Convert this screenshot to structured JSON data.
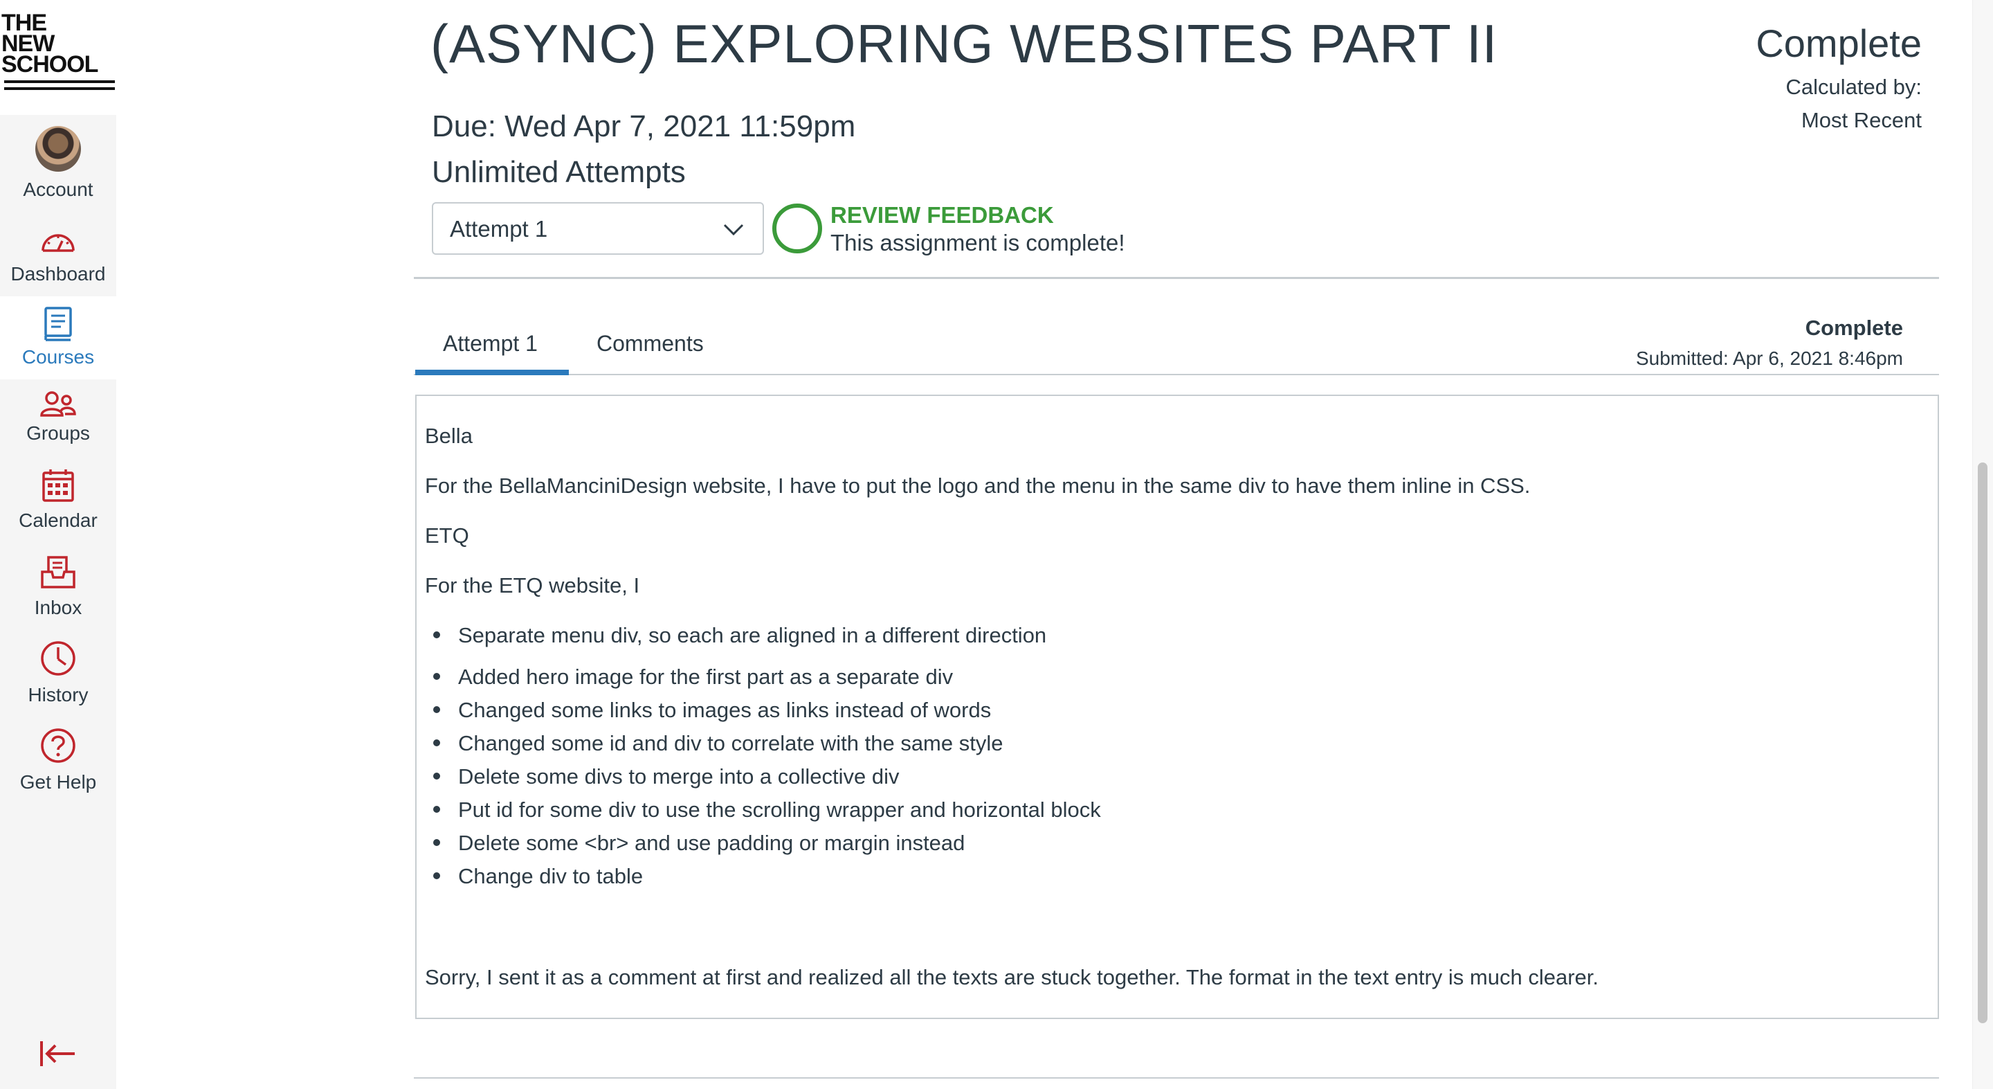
{
  "brand": {
    "logo_lines": [
      "THE",
      "NEW",
      "SCHOOL"
    ]
  },
  "nav": {
    "items": [
      {
        "label": "Account",
        "icon": "avatar"
      },
      {
        "label": "Dashboard",
        "icon": "dashboard-icon"
      },
      {
        "label": "Courses",
        "icon": "courses-icon",
        "active": true
      },
      {
        "label": "Groups",
        "icon": "groups-icon"
      },
      {
        "label": "Calendar",
        "icon": "calendar-icon"
      },
      {
        "label": "Inbox",
        "icon": "inbox-icon"
      },
      {
        "label": "History",
        "icon": "history-icon"
      },
      {
        "label": "Get Help",
        "icon": "help-icon"
      }
    ],
    "collapse_icon": "collapse-nav-icon"
  },
  "assignment": {
    "title": "(ASYNC) EXPLORING WEBSITES PART II",
    "due": "Due: Wed Apr 7, 2021 11:59pm",
    "attempts": "Unlimited Attempts",
    "grade": "Complete",
    "calculated_by_label": "Calculated by:",
    "calculated_by_value": "Most Recent",
    "attempt_select": {
      "value": "Attempt 1"
    },
    "review_feedback": "REVIEW FEEDBACK",
    "complete_message": "This assignment is complete!"
  },
  "tabs": [
    {
      "label": "Attempt 1",
      "active": true
    },
    {
      "label": "Comments",
      "active": false
    }
  ],
  "submission": {
    "status": "Complete",
    "submitted": "Submitted:  Apr 6, 2021 8:46pm",
    "paragraphs": [
      "Bella",
      "For the BellaManciniDesign website, I have to put the logo and the menu in the same div to have them inline in CSS.",
      "ETQ",
      "For the ETQ website, I"
    ],
    "bullets": [
      "Separate menu div, so each are aligned in a different direction",
      "Added hero image for the first part as a separate div",
      "Changed some links to images as links instead of words",
      "Changed some id and div to correlate with the same style",
      "Delete some divs to merge into a collective div",
      "Put id for some div to use the scrolling wrapper and horizontal block",
      "Delete some <br> and use padding or margin instead",
      "Change div to table"
    ],
    "closing": "Sorry, I sent it as a comment at first and realized all the texts are stuck together. The format in the text entry is much clearer."
  },
  "colors": {
    "nav_active": "#2b7abc",
    "icon_red": "#c0262d",
    "feedback_green": "#3b9b3a",
    "text": "#2d3b45",
    "border": "#c7cdd1"
  }
}
